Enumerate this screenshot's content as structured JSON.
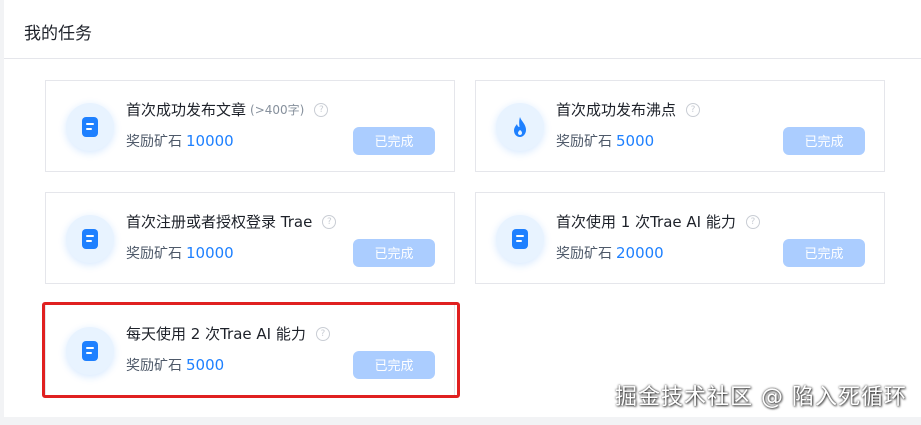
{
  "panel": {
    "title": "我的任务"
  },
  "tasks": [
    {
      "title": "首次成功发布文章",
      "note": "(>400字)",
      "reward_label": "奖励矿石",
      "reward_amount": "10000",
      "status": "已完成",
      "icon": "document-icon"
    },
    {
      "title": "首次成功发布沸点",
      "note": "",
      "reward_label": "奖励矿石",
      "reward_amount": "5000",
      "status": "已完成",
      "icon": "flame-icon"
    },
    {
      "title": "首次注册或者授权登录 Trae",
      "note": "",
      "reward_label": "奖励矿石",
      "reward_amount": "10000",
      "status": "已完成",
      "icon": "document-icon"
    },
    {
      "title": "首次使用 1 次Trae AI 能力",
      "note": "",
      "reward_label": "奖励矿石",
      "reward_amount": "20000",
      "status": "已完成",
      "icon": "document-icon"
    },
    {
      "title": "每天使用 2 次Trae AI 能力",
      "note": "",
      "reward_label": "奖励矿石",
      "reward_amount": "5000",
      "status": "已完成",
      "icon": "document-icon"
    }
  ],
  "help_glyph": "?",
  "watermark": "掘金技术社区 @ 陷入死循环",
  "colors": {
    "accent": "#1e80ff",
    "button_done": "#abcdff",
    "highlight": "#e02020"
  }
}
